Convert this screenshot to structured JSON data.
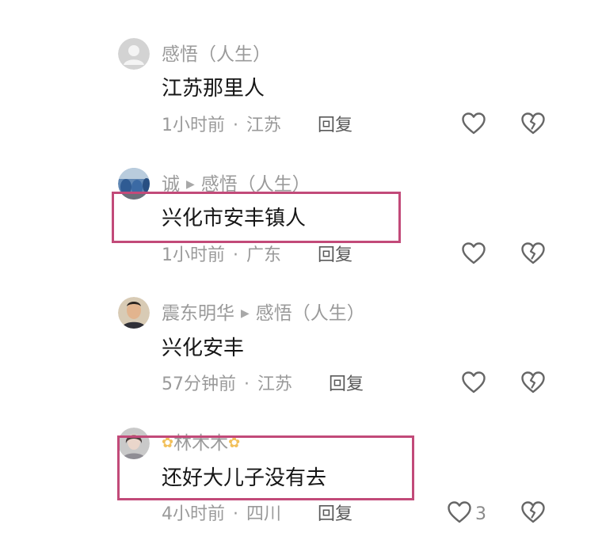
{
  "comments": [
    {
      "author": "感悟（人生）",
      "text": "江苏那里人",
      "time": "1小时前",
      "location": "江苏",
      "reply_label": "回复",
      "avatar": "default-gray-avatar",
      "like_count": ""
    },
    {
      "author": "诚",
      "reply_to": "感悟（人生）",
      "text": "兴化市安丰镇人",
      "time": "1小时前",
      "location": "广东",
      "reply_label": "回复",
      "avatar": "photo-avatar-blue",
      "like_count": "",
      "highlighted": true
    },
    {
      "author": "震东明华",
      "reply_to": "感悟（人生）",
      "text": "兴化安丰",
      "time": "57分钟前",
      "location": "江苏",
      "reply_label": "回复",
      "avatar": "photo-avatar-man",
      "like_count": ""
    },
    {
      "author": "林木木",
      "author_decoration": "flower-emoji",
      "text": "还好大儿子没有去",
      "time": "4小时前",
      "location": "四川",
      "reply_label": "回复",
      "avatar": "photo-avatar-woman",
      "like_count": "3",
      "highlighted": true
    }
  ],
  "icons": {
    "like": "heart-outline-icon",
    "dislike": "broken-heart-icon",
    "reply_arrow": "right-triangle-icon"
  },
  "colors": {
    "highlight_border": "#c24a79",
    "meta_text": "#9a9a9a",
    "body_text": "#161616"
  }
}
